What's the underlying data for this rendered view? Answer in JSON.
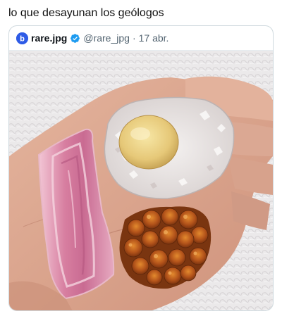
{
  "post": {
    "caption": "lo que desayunan los geólogos"
  },
  "quoted_tweet": {
    "author_name": "rare.jpg",
    "handle": "@rare_jpg",
    "separator": "·",
    "date": "17 abr.",
    "avatar_icon": "blue-logo-b-icon",
    "verified_icon": "verified-badge-icon",
    "accent_color": "#1d9bf0"
  },
  "media": {
    "description_icon": "hand-holding-minerals-photo"
  }
}
